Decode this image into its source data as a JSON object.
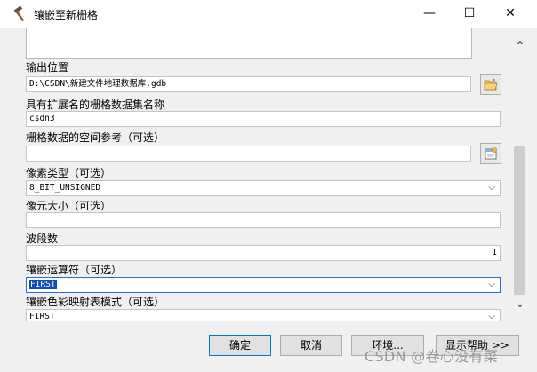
{
  "window": {
    "title": "镶嵌至新栅格",
    "min_glyph": "—",
    "max_glyph": "☐",
    "close_glyph": "✕"
  },
  "form": {
    "output_location": {
      "label": "输出位置",
      "value": "D:\\CSDN\\新建文件地理数据库.gdb"
    },
    "raster_name": {
      "label": "具有扩展名的栅格数据集名称",
      "value": "csdn3"
    },
    "spatial_ref": {
      "label": "栅格数据的空间参考（可选）",
      "value": ""
    },
    "pixel_type": {
      "label": "像素类型（可选）",
      "value": "8_BIT_UNSIGNED"
    },
    "cellsize": {
      "label": "像元大小（可选）",
      "value": ""
    },
    "bands": {
      "label": "波段数",
      "value": "1"
    },
    "mosaic_operator": {
      "label": "镶嵌运算符（可选）",
      "value": "FIRST"
    },
    "colormap_mode": {
      "label": "镶嵌色彩映射表模式（可选）",
      "value": "FIRST"
    }
  },
  "buttons": {
    "ok": "确定",
    "cancel": "取消",
    "environments": "环境...",
    "show_help": "显示帮助 >>"
  },
  "watermark": "CSDN @卷心没有菜",
  "icons": {
    "app": "hammer-icon",
    "browse": "open-folder-icon",
    "spatial_ref": "spatial-reference-icon"
  }
}
